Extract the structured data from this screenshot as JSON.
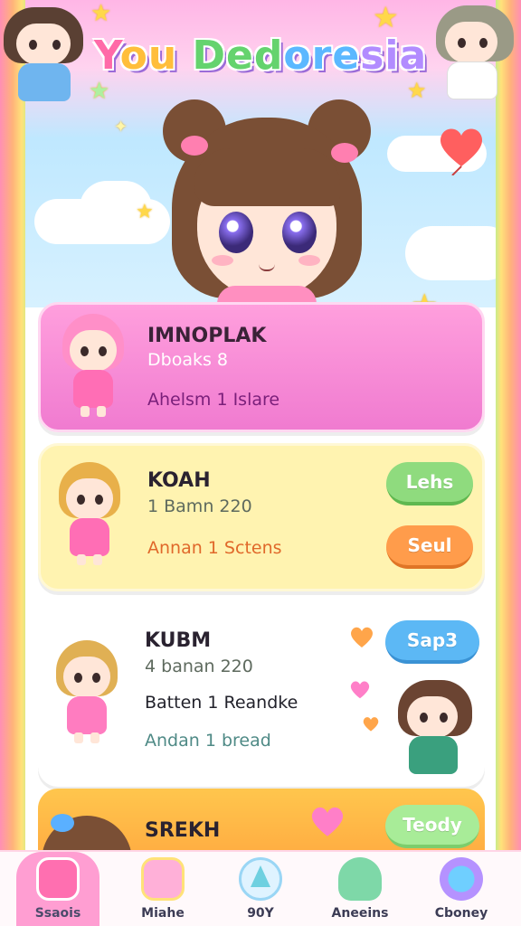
{
  "app": {
    "title_parts": [
      "Y",
      "ou",
      " Ded",
      "ore",
      "sia"
    ]
  },
  "cards": [
    {
      "name": "IMNOPLAK",
      "line1": "Dboaks 8",
      "line2": "Ahelsm 1 Islare"
    },
    {
      "name": "KOAH",
      "line1": "1 Bamn 220",
      "line2": "Annan 1 Sctens",
      "button1": "Lehs",
      "button2": "Seul"
    },
    {
      "name": "KUBM",
      "line1": "4 banan 220",
      "line2": "Batten 1 Reandke",
      "line3": "Andan 1 bread",
      "button1": "Sap3"
    },
    {
      "name": "SREKH",
      "button1": "Teody"
    }
  ],
  "nav": [
    {
      "label": "Ssaois",
      "icon": "envelope-icon",
      "active": true
    },
    {
      "label": "Miahe",
      "icon": "cake-icon"
    },
    {
      "label": "90Y",
      "icon": "tree-icon"
    },
    {
      "label": "Aneeins",
      "icon": "duck-icon"
    },
    {
      "label": "Cboney",
      "icon": "candy-icon"
    }
  ],
  "colors": {
    "pink": "#ff9fdd",
    "yellow": "#fff3b0",
    "orange": "#ffb04a",
    "green": "#8fdb7e",
    "blue": "#5cb8f5"
  }
}
